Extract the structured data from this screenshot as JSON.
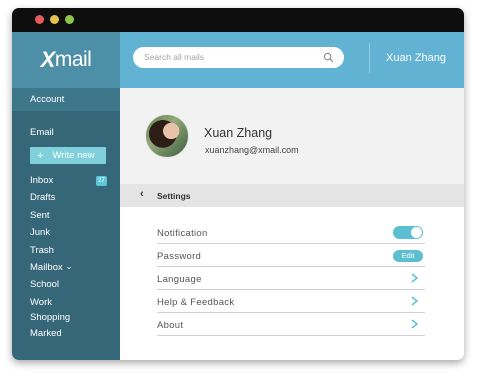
{
  "colors": {
    "titlebar": "#0e0e0e",
    "close": "#e35b5b",
    "minimize": "#e5c14e",
    "maximize": "#8ec64a",
    "sidebar": "#366779",
    "sidebar_header": "#4d8fa6",
    "topbar": "#62b3d3",
    "accent": "#5cbfd0"
  },
  "window_controls": [
    "close",
    "minimize",
    "maximize"
  ],
  "app": {
    "logo_x": "X",
    "logo_rest": "mail"
  },
  "sidebar": {
    "account_label": "Account",
    "email_label": "Email",
    "write_new": {
      "icon": "+",
      "label": "Write new"
    },
    "inbox": {
      "label": "Inbox",
      "badge": "27"
    },
    "folders": [
      "Drafts",
      "Sent",
      "Junk",
      "Trash"
    ],
    "mailbox_label": "Mailbox",
    "mailbox_children": [
      "School",
      "Work",
      "Shopping",
      "Marked"
    ]
  },
  "header": {
    "search_placeholder": "Search all mails",
    "user_name": "Xuan Zhang"
  },
  "profile": {
    "name": "Xuan Zhang",
    "email": "xuanzhang@xmail.com"
  },
  "settings": {
    "back_icon": "chevron-left-icon",
    "title": "Settings",
    "rows": [
      {
        "label": "Notification",
        "control": "toggle",
        "enabled": true
      },
      {
        "label": "Password",
        "control": "button",
        "button_label": "Edit"
      },
      {
        "label": "Language",
        "control": "arrow"
      },
      {
        "label": "Help & Feedback",
        "control": "arrow"
      },
      {
        "label": "About",
        "control": "arrow"
      }
    ]
  }
}
